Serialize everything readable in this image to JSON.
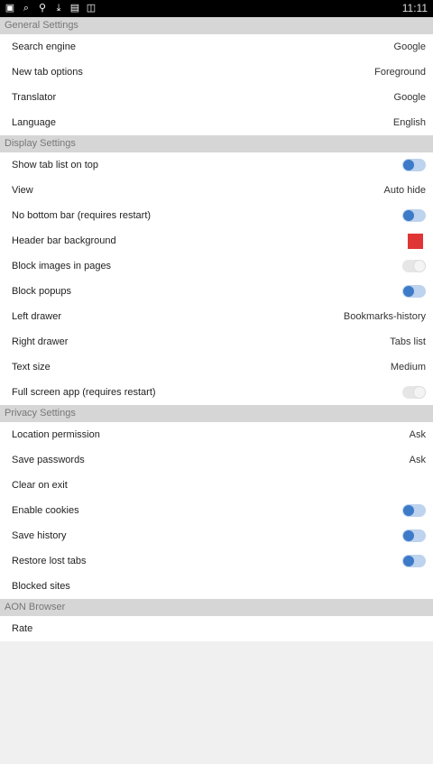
{
  "status_bar": {
    "time": "11:11",
    "icons": [
      "notification-icon",
      "search-icon",
      "usb-icon",
      "download-icon",
      "image-icon",
      "gallery-icon"
    ]
  },
  "colors": {
    "toggle_on": "#3d7ac8",
    "header_bar_background": "#e03535"
  },
  "sections": [
    {
      "title": "General Settings",
      "items": [
        {
          "label": "Search engine",
          "value": "Google"
        },
        {
          "label": "New tab options",
          "value": "Foreground"
        },
        {
          "label": "Translator",
          "value": "Google"
        },
        {
          "label": "Language",
          "value": "English"
        }
      ]
    },
    {
      "title": "Display Settings",
      "items": [
        {
          "label": "Show tab list on top",
          "toggle": true
        },
        {
          "label": "View",
          "value": "Auto hide"
        },
        {
          "label": "No bottom bar (requires restart)",
          "toggle": true
        },
        {
          "label": "Header bar background",
          "color": "#e03535"
        },
        {
          "label": "Block images in pages",
          "toggle": false
        },
        {
          "label": "Block popups",
          "toggle": true
        },
        {
          "label": "Left drawer",
          "value": "Bookmarks-history"
        },
        {
          "label": "Right drawer",
          "value": "Tabs list"
        },
        {
          "label": "Text size",
          "value": "Medium"
        },
        {
          "label": "Full screen app (requires restart)",
          "toggle": false
        }
      ]
    },
    {
      "title": "Privacy Settings",
      "items": [
        {
          "label": "Location permission",
          "value": "Ask"
        },
        {
          "label": "Save passwords",
          "value": "Ask"
        },
        {
          "label": "Clear on exit"
        },
        {
          "label": "Enable cookies",
          "toggle": true
        },
        {
          "label": "Save history",
          "toggle": true
        },
        {
          "label": "Restore lost tabs",
          "toggle": true
        },
        {
          "label": "Blocked sites"
        }
      ]
    },
    {
      "title": "AON Browser",
      "items": [
        {
          "label": "Rate"
        }
      ]
    }
  ]
}
